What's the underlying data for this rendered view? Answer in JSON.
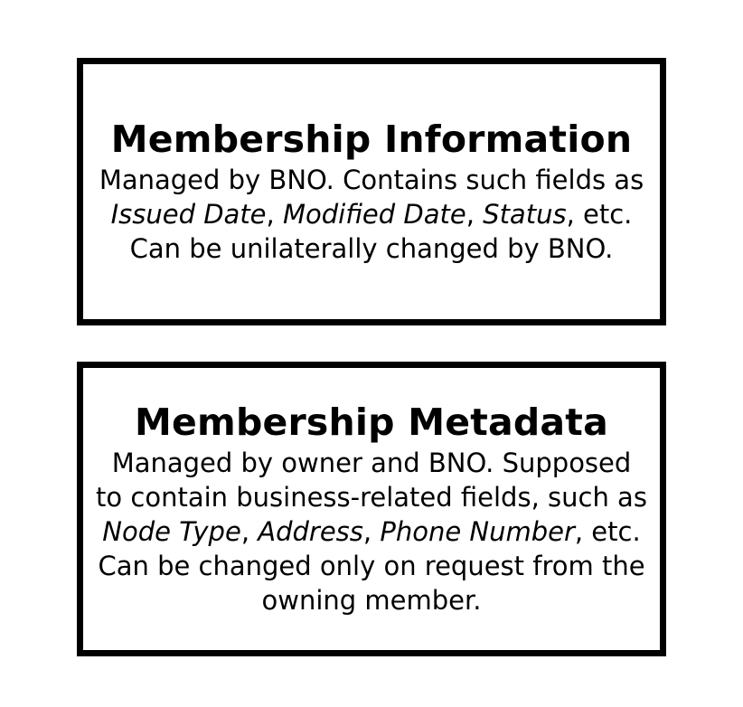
{
  "boxes": [
    {
      "title": "Membership Information",
      "body": {
        "t0": "Managed by BNO. Contains such fields as ",
        "f0": "Issued Date",
        "s0": ", ",
        "f1": "Modified Date",
        "s1": ", ",
        "f2": "Status",
        "t1": ", etc. Can be unilaterally changed by BNO."
      }
    },
    {
      "title": "Membership Metadata",
      "body": {
        "t0": "Managed by owner and BNO. Supposed to contain business-related fields, such as ",
        "f0": "Node Type",
        "s0": ", ",
        "f1": "Address",
        "s1": ", ",
        "f2": "Phone Number",
        "t1": ", etc. Can be changed only on request from the owning member."
      }
    }
  ],
  "colors": {
    "border": "#000000",
    "background": "#ffffff",
    "text": "#000000"
  }
}
